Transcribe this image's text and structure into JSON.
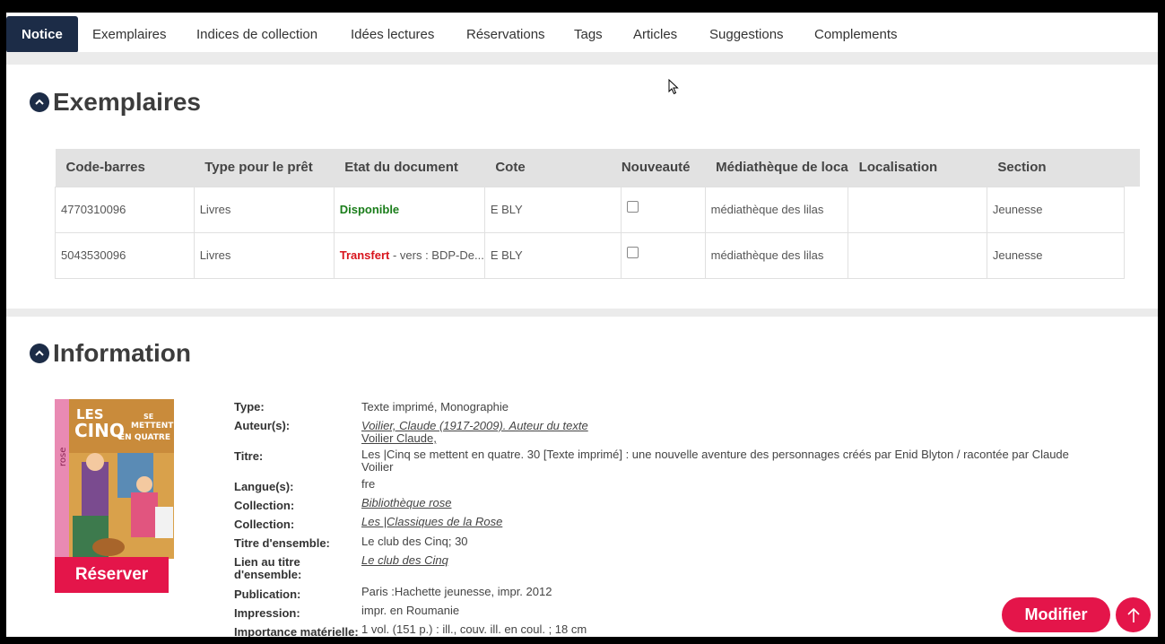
{
  "tabs": [
    {
      "label": "Notice",
      "active": true
    },
    {
      "label": "Exemplaires"
    },
    {
      "label": "Indices de collection"
    },
    {
      "label": "Idées lectures"
    },
    {
      "label": "Réservations"
    },
    {
      "label": "Tags"
    },
    {
      "label": "Articles"
    },
    {
      "label": "Suggestions"
    },
    {
      "label": "Complements"
    }
  ],
  "exemplaires": {
    "title": "Exemplaires",
    "columns": [
      "Code-barres",
      "Type pour le prêt",
      "Etat du document",
      "Cote",
      "Nouveauté",
      "Médiathèque de loca",
      "Localisation",
      "Section"
    ],
    "rows": [
      {
        "barcode": "4770310096",
        "loan_type": "Livres",
        "status": "Disponible",
        "status_extra": "",
        "cote": "E BLY",
        "library": "médiathèque des lilas",
        "location": "",
        "section": "Jeunesse"
      },
      {
        "barcode": "5043530096",
        "loan_type": "Livres",
        "status": "Transfert",
        "status_extra": " - vers : BDP-De...",
        "cote": "E BLY",
        "library": "médiathèque des lilas",
        "location": "",
        "section": "Jeunesse"
      }
    ]
  },
  "information": {
    "title": "Information",
    "cover_text": {
      "les": "LES",
      "cinq": "CINQ",
      "se": "SE",
      "mettent": "METTENT",
      "en_quatre": "EN QUATRE",
      "rose": "rose"
    },
    "reserve_label": "Réserver",
    "fields": {
      "type": {
        "label": "Type:",
        "value": "Texte imprimé, Monographie"
      },
      "authors": {
        "label": "Auteur(s):",
        "link": "Voilier, Claude (1917-2009). Auteur du texte",
        "value": "Voilier Claude,"
      },
      "title": {
        "label": "Titre:",
        "value": "Les |Cinq se mettent en quatre. 30 [Texte imprimé] : une nouvelle aventure des personnages créés par Enid Blyton / racontée par Claude Voilier"
      },
      "language": {
        "label": "Langue(s):",
        "value": "fre"
      },
      "collection1": {
        "label": "Collection:",
        "link": "Bibliothèque rose"
      },
      "collection2": {
        "label": "Collection:",
        "link": "Les |Classiques de la Rose"
      },
      "set_title": {
        "label": "Titre d'ensemble:",
        "value": "Le club des Cinq; 30"
      },
      "set_link": {
        "label": "Lien au titre d'ensemble:",
        "link": "Le club des Cinq"
      },
      "publication": {
        "label": "Publication:",
        "value": "Paris :Hachette jeunesse, impr. 2012"
      },
      "printing": {
        "label": "Impression:",
        "value": "impr. en Roumanie"
      },
      "extent": {
        "label": "Importance matérielle:",
        "value": "1 vol. (151 p.) : ill., couv. ill. en coul. ; 18 cm"
      }
    }
  },
  "actions": {
    "modify_label": "Modifier"
  },
  "colors": {
    "navy": "#1c2c47",
    "accent": "#e4154a",
    "available": "#1a7d1a",
    "transfer": "#d8141c"
  }
}
